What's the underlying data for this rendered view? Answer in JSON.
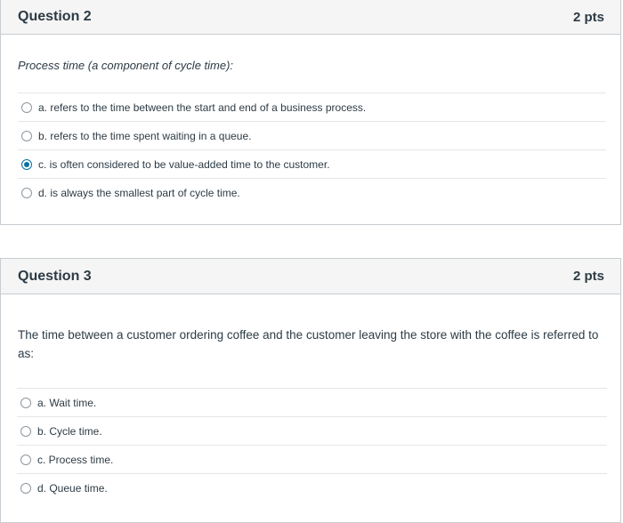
{
  "q2": {
    "title": "Question 2",
    "points": "2 pts",
    "text": "Process time (a component of cycle time):",
    "answers": [
      {
        "label": "a. refers to the time between the start and end of a business process.",
        "selected": false
      },
      {
        "label": "b. refers to the time spent waiting in a queue.",
        "selected": false
      },
      {
        "label": "c. is often considered to be value-added time to the customer.",
        "selected": true
      },
      {
        "label": "d. is always the smallest part of cycle time.",
        "selected": false
      }
    ]
  },
  "q3": {
    "title": "Question 3",
    "points": "2 pts",
    "text": "The time between a customer ordering coffee and the customer leaving the store with the coffee is referred to as:",
    "answers": [
      {
        "label": "a. Wait time.",
        "selected": false
      },
      {
        "label": "b. Cycle time.",
        "selected": false
      },
      {
        "label": "c. Process time.",
        "selected": false
      },
      {
        "label": "d. Queue time.",
        "selected": false
      }
    ]
  },
  "colors": {
    "accent": "#0770a3",
    "header_bg": "#f5f5f5",
    "border": "#c7cdd1",
    "text": "#2d3b45"
  }
}
